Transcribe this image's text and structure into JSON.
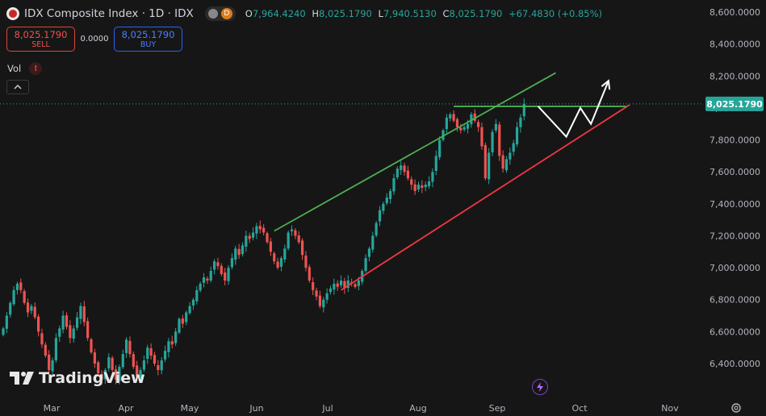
{
  "header": {
    "symbol_title": "IDX Composite Index · 1D · IDX",
    "toggle_label": "D",
    "open_label": "O",
    "open": "7,964.4240",
    "high_label": "H",
    "high": "8,025.1790",
    "low_label": "L",
    "low": "7,940.5130",
    "close_label": "C",
    "close": "8,025.1790",
    "change": "+67.4830 (+0.85%)"
  },
  "trade": {
    "sell_price": "8,025.1790",
    "sell_label": "SELL",
    "spread": "0.0000",
    "buy_price": "8,025.1790",
    "buy_label": "BUY"
  },
  "volume": {
    "label": "Vol",
    "warning_icon": "!"
  },
  "collapse_icon": "chevron-up-icon",
  "branding": {
    "name": "TradingView"
  },
  "colors": {
    "up": "#26a69a",
    "down": "#ef5350",
    "channel_top": "#4caf50",
    "channel_bottom": "#f23645",
    "price_badge": "#26a69a"
  },
  "chart_data": {
    "type": "candlestick",
    "x_ticks": [
      "Mar",
      "Apr",
      "May",
      "Jun",
      "Jul",
      "Aug",
      "Sep",
      "Oct",
      "Nov"
    ],
    "y_ticks": [
      "8,600.0000",
      "8,400.0000",
      "8,200.0000",
      "8,000.0000",
      "7,800.0000",
      "7,600.0000",
      "7,400.0000",
      "7,200.0000",
      "7,000.0000",
      "6,800.0000",
      "6,600.0000",
      "6,400.0000"
    ],
    "ylim": [
      6300,
      8660
    ],
    "last_price": "8,025.1790",
    "grid": false,
    "closes": [
      6620,
      6700,
      6780,
      6860,
      6900,
      6860,
      6780,
      6720,
      6760,
      6690,
      6600,
      6520,
      6450,
      6360,
      6420,
      6560,
      6620,
      6700,
      6630,
      6560,
      6620,
      6690,
      6760,
      6660,
      6560,
      6470,
      6400,
      6340,
      6300,
      6360,
      6440,
      6360,
      6300,
      6380,
      6460,
      6550,
      6460,
      6380,
      6320,
      6360,
      6420,
      6500,
      6450,
      6400,
      6360,
      6420,
      6480,
      6540,
      6520,
      6600,
      6680,
      6650,
      6720,
      6760,
      6800,
      6860,
      6900,
      6940,
      6920,
      6980,
      7040,
      7010,
      6960,
      6920,
      7000,
      7060,
      7120,
      7080,
      7140,
      7200,
      7180,
      7220,
      7260,
      7240,
      7220,
      7160,
      7100,
      7040,
      7000,
      7060,
      7120,
      7220,
      7240,
      7200,
      7160,
      7080,
      7000,
      6920,
      6860,
      6820,
      6760,
      6800,
      6840,
      6870,
      6900,
      6880,
      6920,
      6870,
      6920,
      6900,
      6880,
      6920,
      6980,
      7060,
      7120,
      7200,
      7280,
      7360,
      7400,
      7440,
      7480,
      7560,
      7620,
      7640,
      7600,
      7560,
      7520,
      7480,
      7520,
      7500,
      7520,
      7540,
      7600,
      7700,
      7800,
      7860,
      7940,
      7960,
      7920,
      7880,
      7860,
      7880,
      7900,
      7960,
      7920,
      7880,
      7760,
      7560,
      7720,
      7850,
      7900,
      7700,
      7620,
      7680,
      7720,
      7780,
      7880,
      7940,
      8025
    ],
    "channel": {
      "upper": [
        {
          "date_index": 77,
          "value": 7230
        },
        {
          "date_index": 157,
          "value": 8220
        }
      ],
      "lower": [
        {
          "date_index": 96,
          "value": 6860
        },
        {
          "date_index": 178,
          "value": 8020
        }
      ],
      "resistance": [
        {
          "date_index": 128,
          "value": 8010
        },
        {
          "date_index": 177,
          "value": 8010
        }
      ]
    },
    "projection": [
      {
        "date_index": 152,
        "value": 8010
      },
      {
        "date_index": 160,
        "value": 7820
      },
      {
        "date_index": 164,
        "value": 8000
      },
      {
        "date_index": 167,
        "value": 7900
      },
      {
        "date_index": 172,
        "value": 8170
      }
    ]
  }
}
